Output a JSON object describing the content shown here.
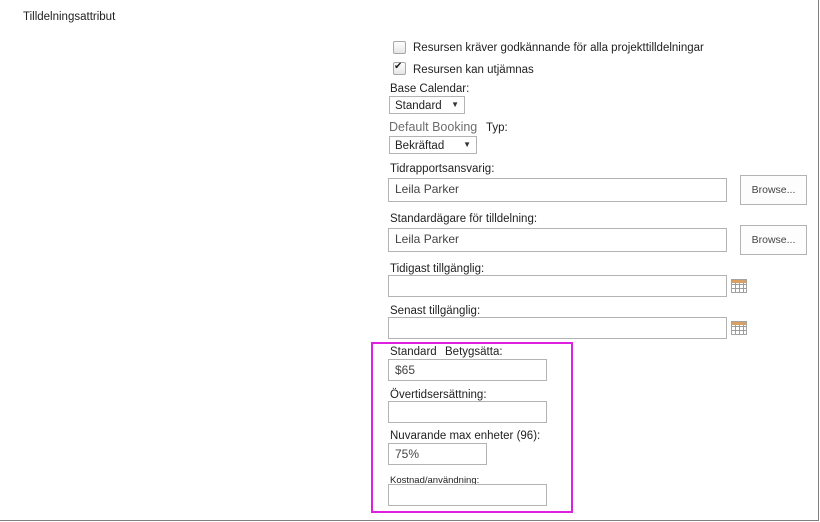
{
  "section": {
    "title": "Tilldelningsattribut"
  },
  "checkboxes": [
    {
      "label": "Resursen kräver godkännande för alla projekttilldelningar",
      "checked": false
    },
    {
      "label": "Resursen kan utjämnas",
      "checked": true
    }
  ],
  "base_calendar": {
    "label": "Base Calendar:",
    "value": "Standard"
  },
  "default_booking": {
    "label_part1": "Default Booking",
    "label_part2": "Typ:",
    "value": "Bekräftad"
  },
  "timesheet_manager": {
    "label": "Tidrapportsansvarig:",
    "value": "Leila Parker",
    "browse_label": "Browse..."
  },
  "default_assignment_owner": {
    "label": "Standardägare för tilldelning:",
    "value": "Leila Parker",
    "browse_label": "Browse..."
  },
  "earliest_available": {
    "label": "Tidigast tillgänglig:",
    "value": ""
  },
  "latest_available": {
    "label": "Senast tillgänglig:",
    "value": ""
  },
  "standard_rate": {
    "label_part1": "Standard",
    "label_part2": "Betygsätta:",
    "value": "$65"
  },
  "overtime_rate": {
    "label": "Övertidsersättning:",
    "value": ""
  },
  "max_units": {
    "label": "Nuvarande max enheter (96):",
    "value": "75%"
  },
  "cost_per_use": {
    "label": "Kostnad/användning:",
    "value": ""
  },
  "colors": {
    "highlight": "#e020e0",
    "border": "#b3b3b3"
  },
  "icons": {
    "calendar": "calendar-icon",
    "dropdown": "chevron-down-icon",
    "check": "checkmark-icon"
  }
}
